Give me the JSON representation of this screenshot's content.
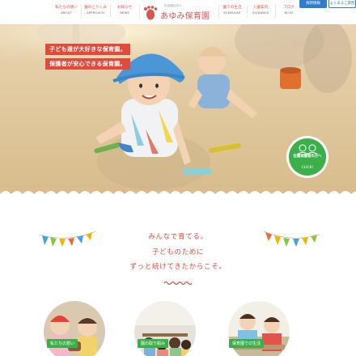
{
  "header": {
    "nav_left": [
      {
        "jp": "私たちの想い",
        "en": "ABOUT"
      },
      {
        "jp": "園のとりくみ",
        "en": "APPROACH"
      },
      {
        "jp": "お知らせ",
        "en": "NEWS"
      }
    ],
    "nav_right": [
      {
        "jp": "園での生活",
        "en": "SCHEDULE"
      },
      {
        "jp": "入園案内",
        "en": "GUIDANCE"
      },
      {
        "jp": "ブログ",
        "en": "BLOG"
      }
    ],
    "logo_small": "社会福祉法人",
    "logo_name": "あゆみ保育園",
    "recruit_label": "採用情報",
    "faq_label": "よくあるご質問"
  },
  "hero": {
    "catch_1": "子ども達が大好きな保育園。",
    "catch_2": "保護者が安心できる保育園。",
    "guide_text": "在園保護者の方へ",
    "guide_click": "CLICK!"
  },
  "message": {
    "line_1": "みんなで育てる。",
    "line_2": "子どものために",
    "line_3": "ずっと続けてきたからこそ。"
  },
  "cards": [
    {
      "label": "私たちの想い"
    },
    {
      "label": "園の取り組み"
    },
    {
      "label": "保育園での生活"
    }
  ],
  "colors": {
    "accent_red": "#e04b3c",
    "green": "#3bb04a",
    "blue": "#2f7fc8"
  }
}
